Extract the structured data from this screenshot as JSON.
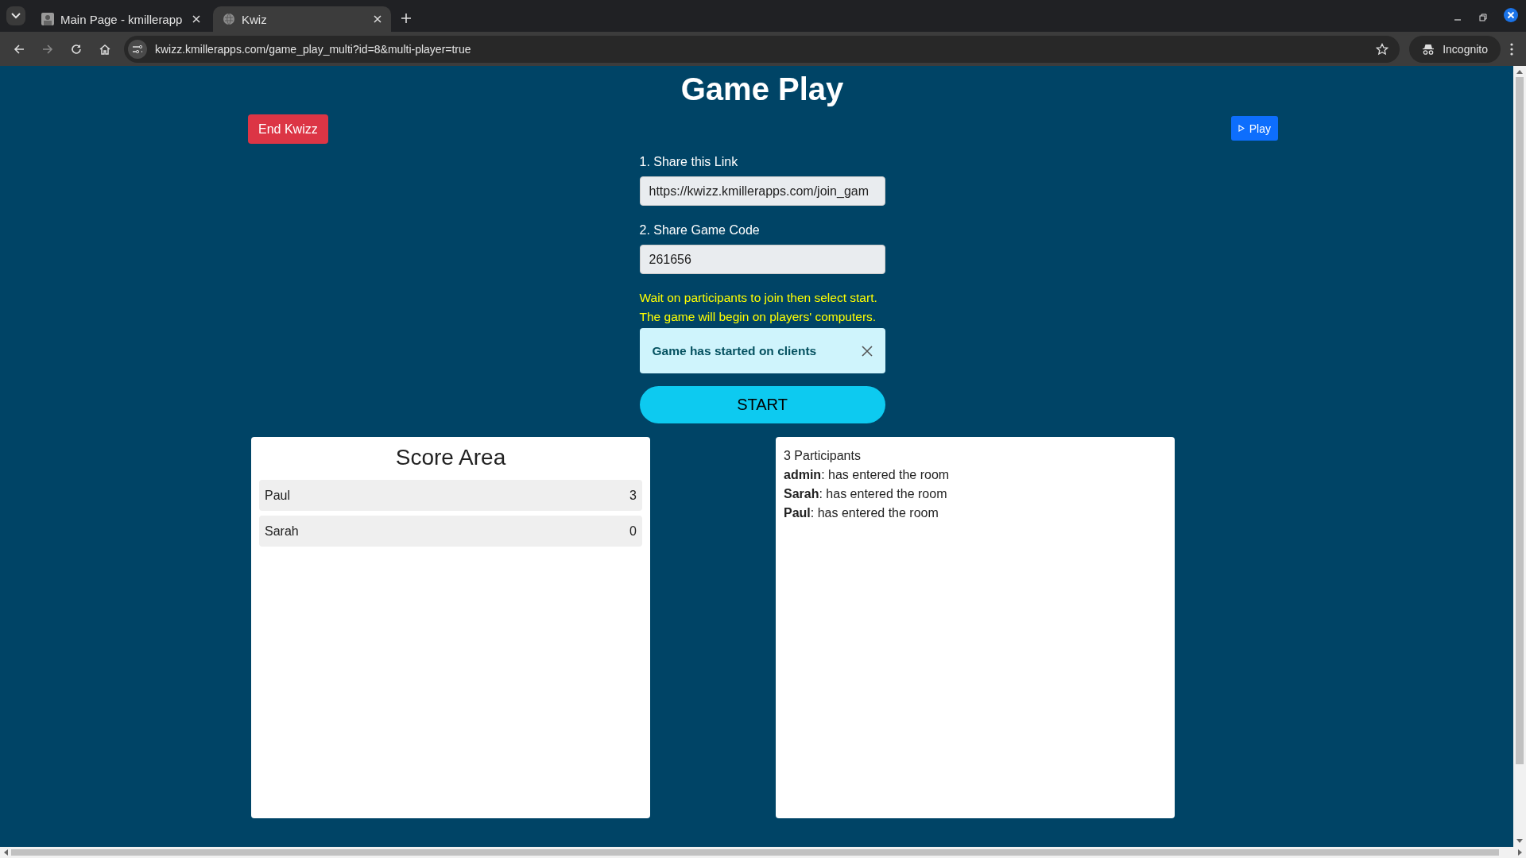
{
  "browser": {
    "tabs": [
      {
        "title": "Main Page - kmillerapp",
        "selected": false
      },
      {
        "title": "Kwiz",
        "selected": true
      }
    ],
    "url": "kwizz.kmillerapps.com/game_play_multi?id=8&multi-player=true",
    "profile": "Incognito"
  },
  "page": {
    "title": "Game Play",
    "end_button": "End Kwizz",
    "play_button": "Play",
    "fields": [
      {
        "label": "1. Share this Link",
        "value": "https://kwizz.kmillerapps.com/join_gam"
      },
      {
        "label": "2. Share Game Code",
        "value": "261656"
      }
    ],
    "notes": [
      "Wait on participants to join then select start.",
      "The game will begin on players' computers."
    ],
    "alert": "Game has started on clients",
    "start_button": "START",
    "score_area": {
      "title": "Score Area",
      "rows": [
        {
          "name": "Paul",
          "score": "3"
        },
        {
          "name": "Sarah",
          "score": "0"
        }
      ]
    },
    "participants": {
      "count_label": "3 Participants",
      "events": [
        "**admin**: has entered the room",
        "**Sarah**: has entered the room",
        "**Paul**: has entered the room"
      ]
    }
  }
}
